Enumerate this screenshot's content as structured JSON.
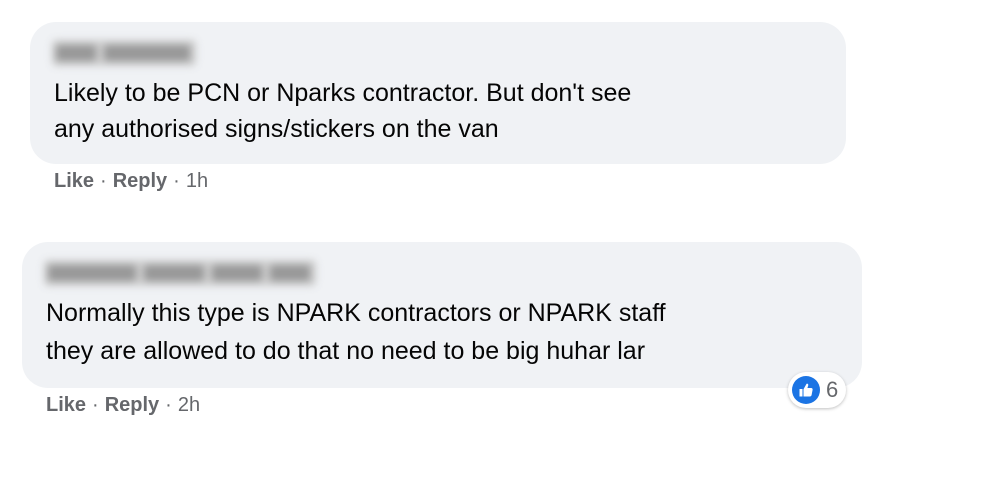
{
  "comments": [
    {
      "text_lines": [
        "Likely to be PCN or Nparks contractor. But don't see",
        "any authorised signs/stickers on the van"
      ],
      "like_label": "Like",
      "reply_label": "Reply",
      "separator": "·",
      "time": "1h"
    },
    {
      "text_lines": [
        "Normally this type is NPARK contractors or NPARK staff",
        "they are allowed to do that no need to be big huhar lar"
      ],
      "like_label": "Like",
      "reply_label": "Reply",
      "separator": "·",
      "time": "2h",
      "reaction": {
        "icon": "thumbs-up-icon",
        "count": "6",
        "color": "#1b74e4"
      }
    }
  ]
}
